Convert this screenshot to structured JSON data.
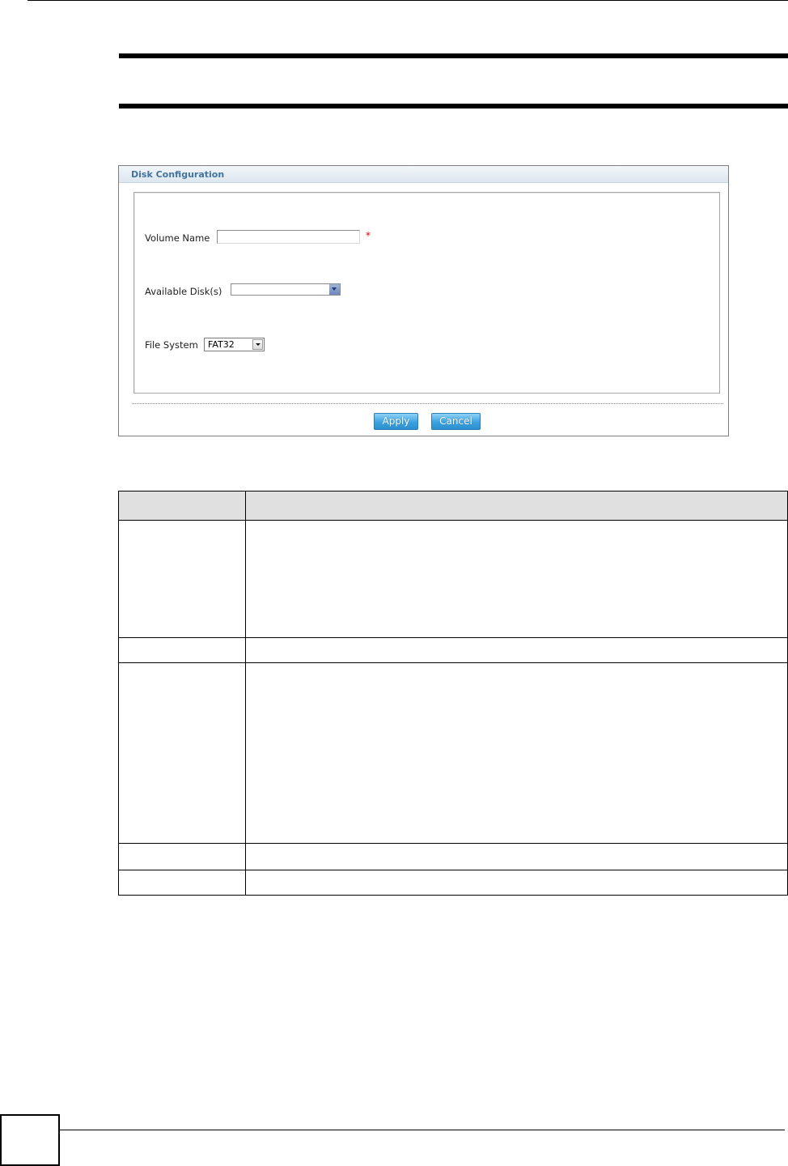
{
  "disk_configuration": {
    "title": "Disk Configuration",
    "volume_name": {
      "label": "Volume Name",
      "value": "",
      "required_mark": "*"
    },
    "available_disks": {
      "label": "Available Disk(s)",
      "selected": ""
    },
    "file_system": {
      "label": "File System",
      "selected": "FAT32"
    },
    "apply_label": "Apply",
    "cancel_label": "Cancel"
  },
  "colors": {
    "panel_title": "#42749f",
    "button": "#3aa2e0",
    "required": "#e00000",
    "table_header": "#e0e0e0"
  },
  "icons": [
    "dropdown-arrow-icon"
  ]
}
